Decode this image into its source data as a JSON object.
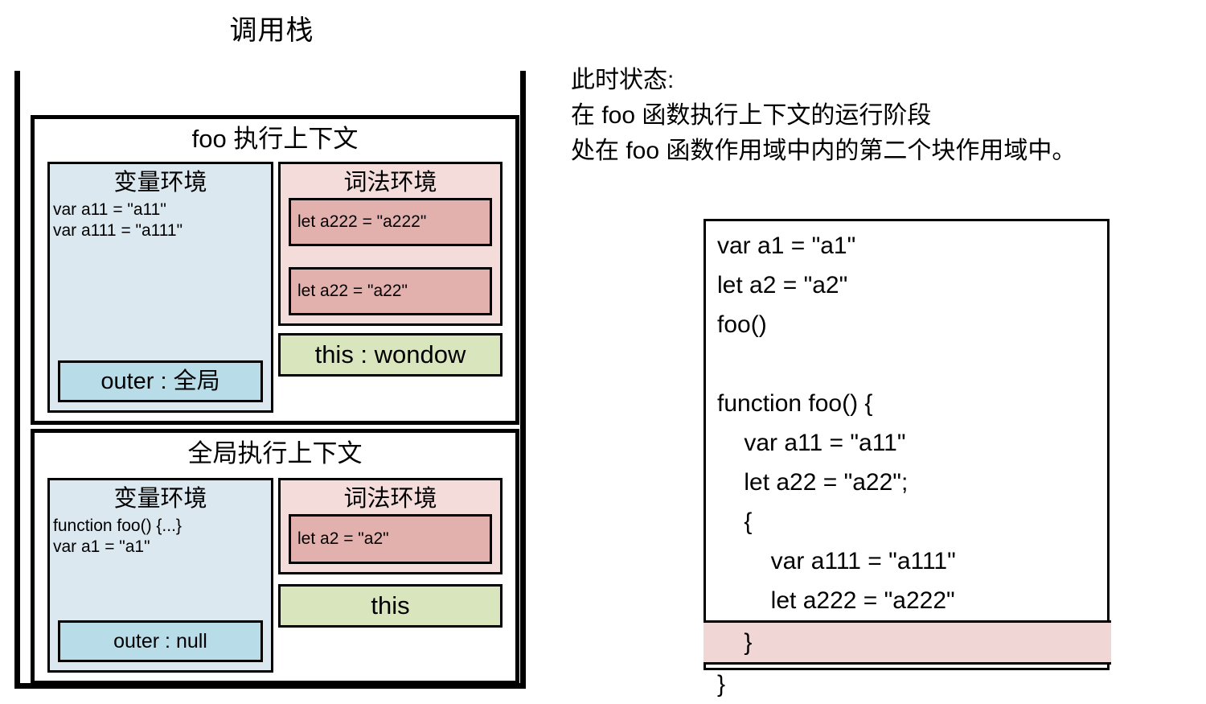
{
  "stack": {
    "title": "调用栈",
    "frames": [
      {
        "id": "foo",
        "title": "foo 执行上下文",
        "variable_environment": {
          "heading": "变量环境",
          "declarations": [
            "var a11 = \"a11\"",
            "var a111 = \"a111\""
          ],
          "outer": "outer : 全局"
        },
        "lexical_environment": {
          "heading": "词法环境",
          "items": [
            "let a222 = \"a222\"",
            "let a22 = \"a22\""
          ]
        },
        "this_binding": "this : wondow"
      },
      {
        "id": "global",
        "title": "全局执行上下文",
        "variable_environment": {
          "heading": "变量环境",
          "declarations": [
            "function foo() {...}",
            "var a1 = \"a1\""
          ],
          "outer": "outer : null"
        },
        "lexical_environment": {
          "heading": "词法环境",
          "items": [
            "let a2 = \"a2\""
          ]
        },
        "this_binding": "this"
      }
    ]
  },
  "note": {
    "lines": [
      "此时状态:",
      "在 foo 函数执行上下文的运行阶段",
      "处在 foo 函数作用域中内的第二个块作用域中。"
    ]
  },
  "code": {
    "lines": [
      {
        "text": "var a1 = \"a1\"",
        "highlight": false
      },
      {
        "text": "let a2 = \"a2\"",
        "highlight": false
      },
      {
        "text": "foo()",
        "highlight": false
      },
      {
        "text": "",
        "highlight": false
      },
      {
        "text": "function foo() {",
        "highlight": false
      },
      {
        "text": "    var a11 = \"a11\"",
        "highlight": false
      },
      {
        "text": "    let a22 = \"a22\";",
        "highlight": false
      },
      {
        "text": "    {",
        "highlight": false
      },
      {
        "text": "        var a111 = \"a111\"",
        "highlight": false
      },
      {
        "text": "        let a222 = \"a222\"",
        "highlight": false
      },
      {
        "text": "    }",
        "highlight": true
      },
      {
        "text": "}",
        "highlight": false
      }
    ]
  },
  "colors": {
    "variable_environment_bg": "#dbe8ef",
    "lexical_environment_bg": "#f4dcdb",
    "lexical_item_bg": "#e3b1ad",
    "outer_chip_bg": "#b9dce9",
    "this_chip_bg": "#d9e5bd",
    "code_highlight_bg": "#f0d6d4",
    "stroke": "#000000"
  }
}
